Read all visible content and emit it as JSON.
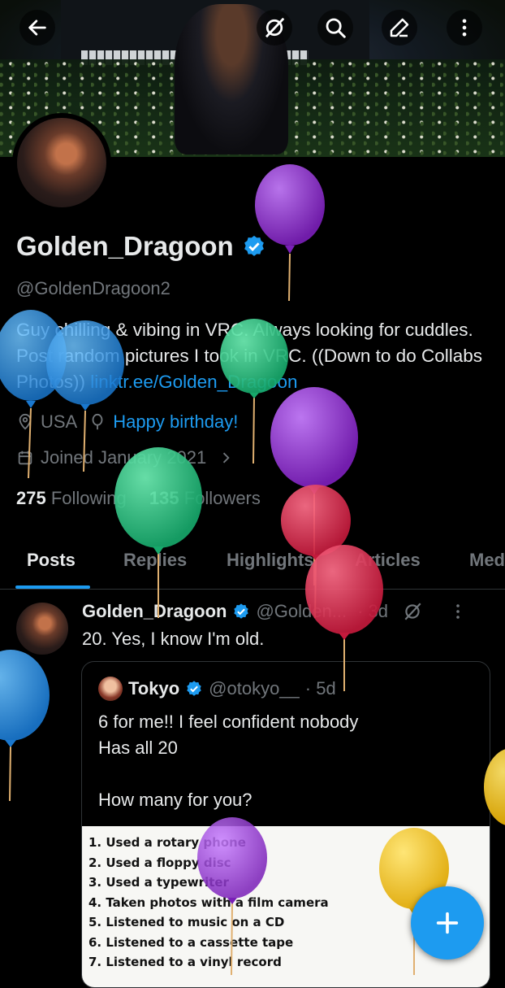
{
  "header": {
    "back_icon": "arrow-left-icon",
    "icons": [
      "hide-icon",
      "search-icon",
      "edit-icon",
      "more-vertical-icon"
    ]
  },
  "profile": {
    "display_name": "Golden_Dragoon",
    "handle": "@GoldenDragoon2",
    "bio_text": "Guy chilling & vibing in VRC. Always looking for cuddles. Post random pictures I took in VRC. ((Down to do Collabs Photos)) ",
    "bio_link": "linktr.ee/Golden_Dragoon",
    "location": "USA",
    "birthday": "Happy birthday!",
    "joined": "Joined January 2021",
    "following_count": "275",
    "following_label": "Following",
    "followers_count": "135",
    "followers_label": "Followers"
  },
  "tabs": [
    "Posts",
    "Replies",
    "Highlights",
    "Articles",
    "Media"
  ],
  "post": {
    "author": "Golden_Dragoon",
    "handle": "@Golden...",
    "time": "· 3d",
    "text": "20. Yes, I know I'm old.",
    "quote": {
      "author": "Tokyo",
      "handle": "@otokyo__",
      "time": "· 5d",
      "line1": "6 for me!! I feel confident nobody",
      "line2": "Has all 20",
      "line3": "How many for you?",
      "list": [
        "1. Used a rotary phone",
        "2. Used a floppy disc",
        "3. Used a typewriter",
        "4. Taken photos with a film camera",
        "5. Listened to music on a CD",
        "6. Listened to a cassette tape",
        "7. Listened to a vinyl record"
      ]
    }
  },
  "fab": {
    "icon": "plus-icon"
  },
  "colors": {
    "accent": "#1d9bf0",
    "background": "#000000",
    "secondary_text": "#71767b"
  }
}
